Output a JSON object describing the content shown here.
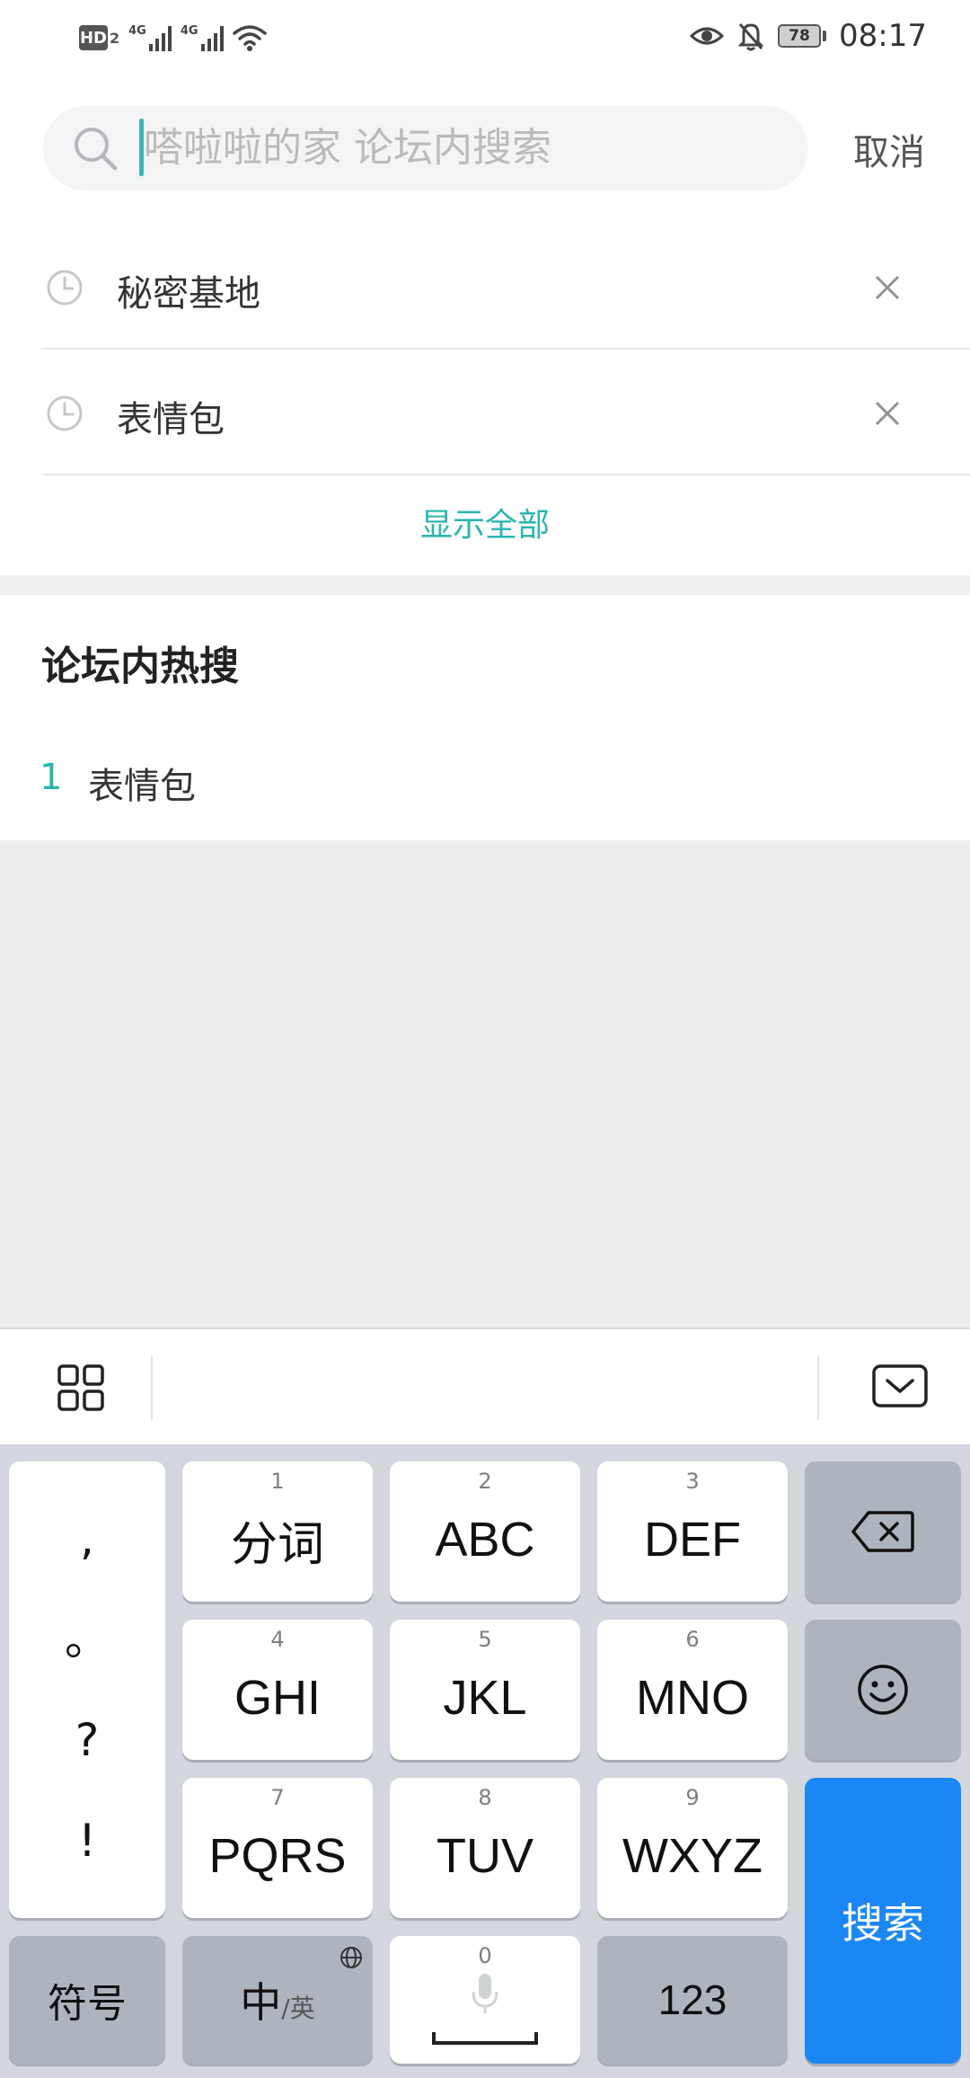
{
  "status_bar": {
    "hd_label": "HD",
    "hd_sub": "2",
    "sig1_label": "4G",
    "sig2_label": "4G",
    "battery": "78",
    "time": "08:17"
  },
  "search": {
    "placeholder": "嗒啦啦的家 论坛内搜索",
    "value": "",
    "cancel_label": "取消"
  },
  "history": {
    "items": [
      {
        "label": "秘密基地"
      },
      {
        "label": "表情包"
      }
    ],
    "show_all_label": "显示全部"
  },
  "hot_search": {
    "title": "论坛内热搜",
    "items": [
      {
        "rank": "1",
        "label": "表情包"
      }
    ]
  },
  "keyboard": {
    "punctuation": [
      ",",
      "。",
      "?",
      "!"
    ],
    "keys": [
      {
        "num": "1",
        "label": "分词"
      },
      {
        "num": "2",
        "label": "ABC"
      },
      {
        "num": "3",
        "label": "DEF"
      },
      {
        "num": "4",
        "label": "GHI"
      },
      {
        "num": "5",
        "label": "JKL"
      },
      {
        "num": "6",
        "label": "MNO"
      },
      {
        "num": "7",
        "label": "PQRS"
      },
      {
        "num": "8",
        "label": "TUV"
      },
      {
        "num": "9",
        "label": "WXYZ"
      }
    ],
    "symbol_label": "符号",
    "lang_main": "中",
    "lang_sub": "/英",
    "space_num": "0",
    "num_switch_label": "123",
    "search_label": "搜索"
  },
  "colors": {
    "accent": "#2bb5b0",
    "search_key": "#1b87f5",
    "keyboard_bg": "#d3d6dc",
    "gray_key": "#aeb4be"
  },
  "icons": {
    "search": "search-icon",
    "history": "clock-icon",
    "remove": "close-icon",
    "toolbar_menu": "grid-icon",
    "toolbar_hide": "keyboard-hide-icon",
    "backspace": "backspace-icon",
    "emoji": "emoji-icon",
    "globe": "globe-icon",
    "microphone": "microphone-icon"
  }
}
